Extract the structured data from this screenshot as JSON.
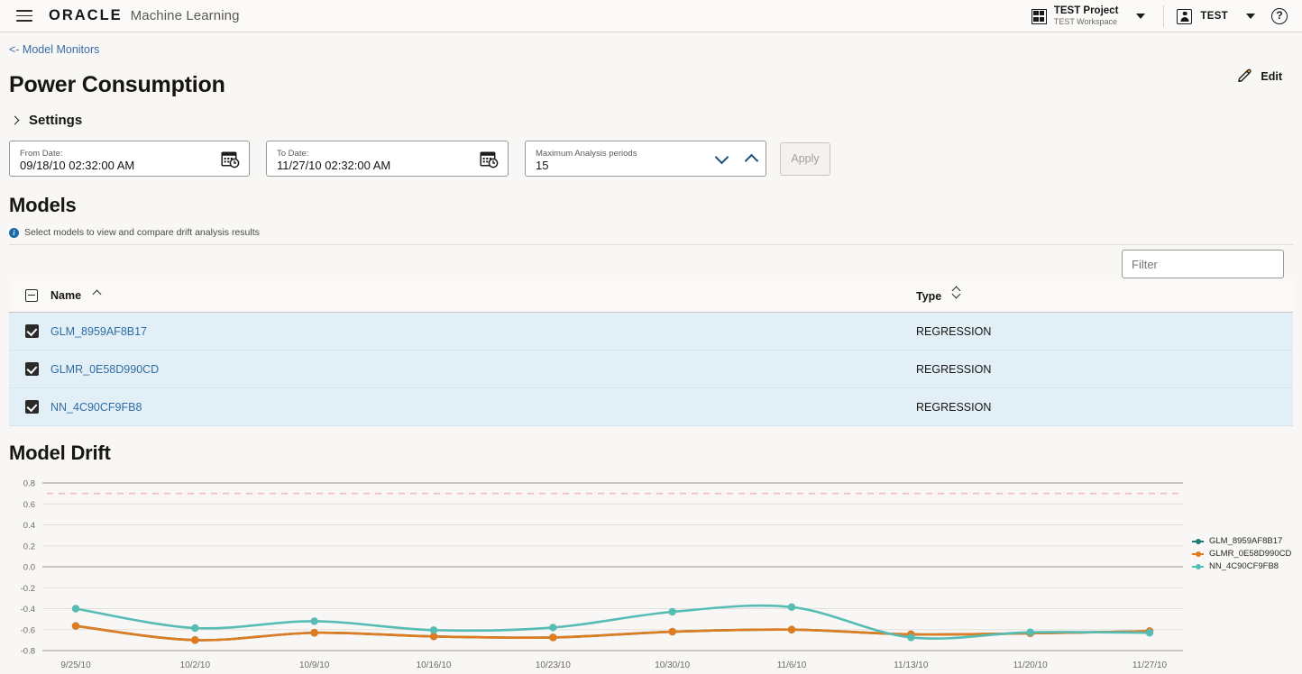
{
  "topbar": {
    "menu_icon": "hamburger-icon",
    "brand": "ORACLE",
    "app_name": "Machine Learning",
    "project_icon": "grid-icon",
    "project_title": "TEST Project",
    "project_subtitle": "TEST Workspace",
    "project_caret": "chevron-down-icon",
    "user_icon": "user-icon",
    "user_name": "TEST",
    "user_caret": "chevron-down-icon",
    "help_icon": "help-icon",
    "help_glyph": "?"
  },
  "breadcrumb": {
    "label": "<- Model Monitors"
  },
  "page": {
    "title": "Power Consumption",
    "edit_label": "Edit",
    "edit_icon": "pencil-icon",
    "settings_label": "Settings",
    "settings_chevron": "chevron-right-icon"
  },
  "filters": {
    "from_date": {
      "label": "From Date:",
      "value": "09/18/10 02:32:00 AM",
      "icon": "calendar-clock-icon"
    },
    "to_date": {
      "label": "To Date:",
      "value": "11/27/10 02:32:00 AM",
      "icon": "calendar-clock-icon"
    },
    "periods": {
      "label": "Maximum Analysis periods",
      "value": "15",
      "down_icon": "chevron-down-icon",
      "up_icon": "chevron-up-icon"
    },
    "apply_label": "Apply"
  },
  "models": {
    "heading": "Models",
    "hint": "Select models to view and compare drift analysis results",
    "hint_icon": "info-icon",
    "filter_placeholder": "Filter",
    "columns": [
      "Name",
      "Type"
    ],
    "select_all_icon": "indeterminate-checkbox-icon",
    "rows": [
      {
        "checked": true,
        "name": "GLM_8959AF8B17",
        "type": "REGRESSION"
      },
      {
        "checked": true,
        "name": "GLMR_0E58D990CD",
        "type": "REGRESSION"
      },
      {
        "checked": true,
        "name": "NN_4C90CF9FB8",
        "type": "REGRESSION"
      }
    ]
  },
  "drift": {
    "heading": "Model Drift"
  },
  "chart_data": {
    "type": "line",
    "title": "Model Drift",
    "xlabel": "",
    "ylabel": "",
    "ylim": [
      -0.8,
      0.8
    ],
    "yticks": [
      "0.8",
      "0.6",
      "0.4",
      "0.2",
      "0.0",
      "-0.2",
      "-0.4",
      "-0.6",
      "-0.8"
    ],
    "ytick_values": [
      0.8,
      0.6,
      0.4,
      0.2,
      0.0,
      -0.2,
      -0.4,
      -0.6,
      -0.8
    ],
    "grid": true,
    "legend_position": "right",
    "threshold_line": {
      "value": 0.7,
      "color": "#f4b8b8",
      "style": "dashed"
    },
    "categories": [
      "9/25/10",
      "10/2/10",
      "10/9/10",
      "10/16/10",
      "10/23/10",
      "10/30/10",
      "11/6/10",
      "11/13/10",
      "11/20/10",
      "11/27/10"
    ],
    "series": [
      {
        "name": "GLM_8959AF8B17",
        "color": "#1f7a7a",
        "values": [
          -0.565,
          -0.7,
          -0.63,
          -0.665,
          -0.675,
          -0.62,
          -0.6,
          -0.645,
          -0.635,
          -0.615
        ]
      },
      {
        "name": "GLMR_0E58D990CD",
        "color": "#e07b1f",
        "values": [
          -0.565,
          -0.7,
          -0.63,
          -0.665,
          -0.675,
          -0.62,
          -0.6,
          -0.645,
          -0.635,
          -0.615
        ]
      },
      {
        "name": "NN_4C90CF9FB8",
        "color": "#57bdb4",
        "values": [
          -0.4,
          -0.585,
          -0.52,
          -0.605,
          -0.58,
          -0.43,
          -0.385,
          -0.675,
          -0.625,
          -0.63
        ]
      }
    ]
  }
}
